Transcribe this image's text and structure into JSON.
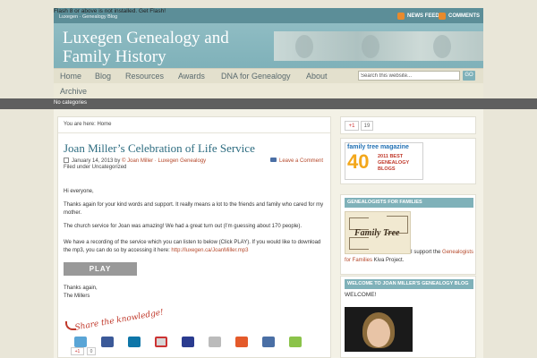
{
  "flash": {
    "message": "Flash 8 or above is not installed. Get Flash!",
    "subtext": "Luxegen · Genealogy Blog"
  },
  "topbar": {
    "news_feed_label": "NEWS FEED",
    "comments_feed_label": "COMMENTS"
  },
  "header": {
    "site_title": "Luxegen Genealogy and Family History"
  },
  "nav": {
    "items": [
      {
        "label": "Home"
      },
      {
        "label": "Blog"
      },
      {
        "label": "Resources"
      },
      {
        "label": "Awards"
      },
      {
        "label": "DNA for Genealogy"
      },
      {
        "label": "About"
      }
    ],
    "second_row_item": "Archive",
    "search_value": "Search this website...",
    "search_button": "GO"
  },
  "category_bar": {
    "text": "No categories"
  },
  "post": {
    "breadcrumb": "You are here: Home",
    "title": "Joan Miller’s Celebration of Life Service",
    "date_author_prefix": "January 14, 2013 by ",
    "author_link": "© Joan Miller · Luxegen Genealogy",
    "leave_comment": "Leave a Comment",
    "filed_under": "Filed under Uncategorized",
    "greeting": "Hi everyone,",
    "para1": "Thanks again for your kind words and support. It really means a lot to the friends and family who cared for my mother.",
    "para2": "The church service for Joan was amazing! We had a great turn out (I’m guessing about 170 people).",
    "para3_text": "We have a recording of the service which you can listen to below (Click PLAY). If you would like to download the mp3, you can do so by accessing it here: ",
    "para3_link": "http://luxegen.ca/JoanMiller.mp3",
    "play_label": "PLAY",
    "closing_line1": "Thanks again,",
    "closing_line2": "The Millers",
    "share_text": "Share the knowledge!",
    "gplus_label": "+1",
    "gplus_count": "0"
  },
  "sidebar": {
    "gplus_label": "+1",
    "gplus_count": "19",
    "award": {
      "magazine": "family tree magazine",
      "number": "40",
      "line1": "2011 BEST",
      "line2": "GENEALOGY",
      "line3": "BLOGS"
    },
    "widget1_title": "GENEALOGISTS FOR FAMILIES",
    "tree_label": "Family Tree",
    "kiva_text": "I support the ",
    "kiva_link": "Genealogists for Families",
    "kiva_suffix": " Kiva Project.",
    "widget2_title": "WELCOME TO JOAN MILLER'S GENEALOGY BLOG",
    "welcome": "WELCOME!"
  },
  "colors": {
    "teal": "#7fb1b9",
    "link": "#b5492b",
    "title": "#2d6c80"
  }
}
